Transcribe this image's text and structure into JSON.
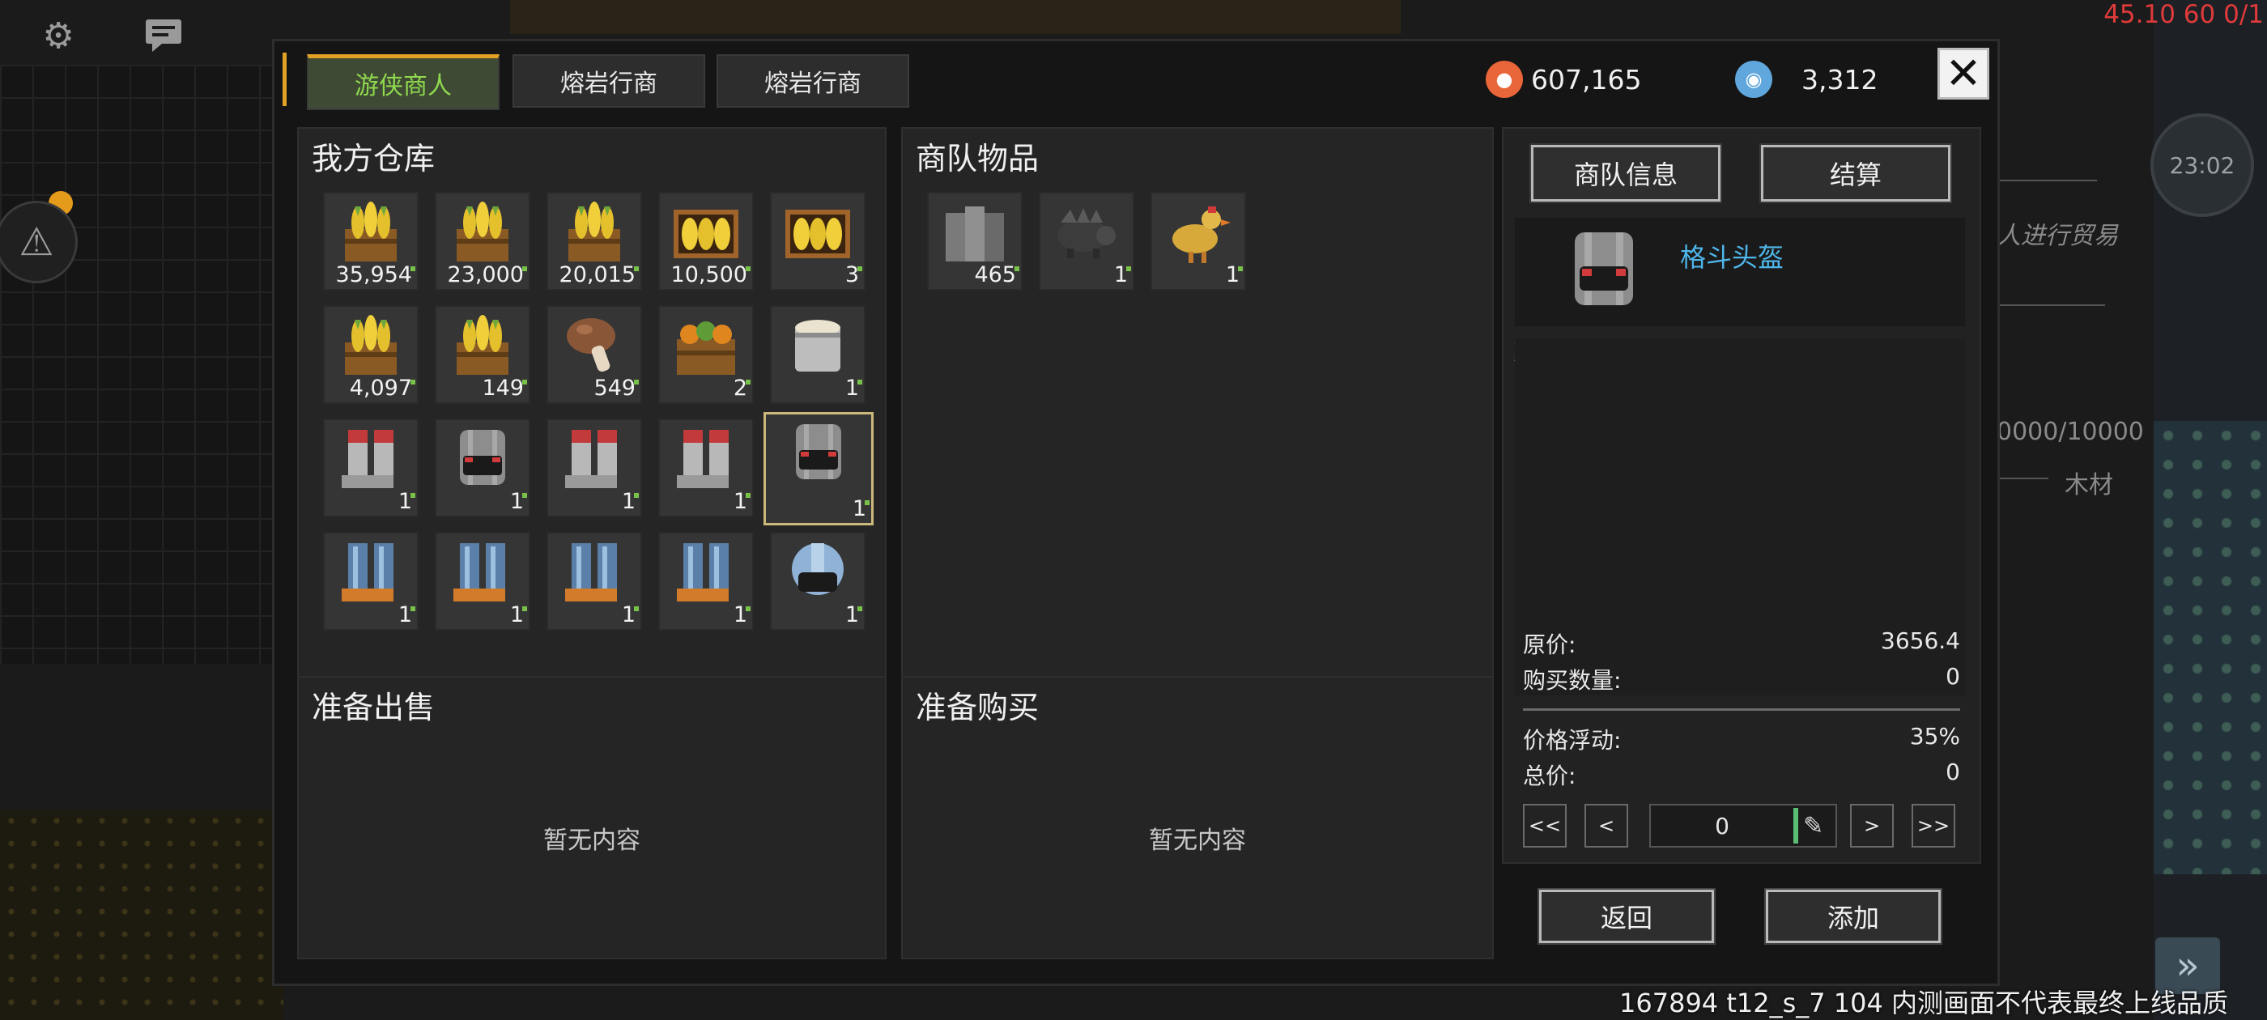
{
  "status_overlay": "45.10 60 0/1",
  "clock": "23:02",
  "side_texts": {
    "trade_hint": "人进行贸易",
    "capacity": "0000/10000",
    "wood": "木材"
  },
  "watermark": "167894 t12_s_7 104 内测画面不代表最终上线品质",
  "tabs": [
    {
      "label": "游侠商人",
      "active": true
    },
    {
      "label": "熔岩行商",
      "active": false
    },
    {
      "label": "熔岩行商",
      "active": false
    }
  ],
  "currency": {
    "silver": "607,165",
    "tokens": "3,312"
  },
  "close_label": "✕",
  "warehouse": {
    "title": "我方仓库",
    "items": [
      {
        "icon": "corn-crate-icon",
        "count": "35,954"
      },
      {
        "icon": "corn-crate-icon",
        "count": "23,000"
      },
      {
        "icon": "corn-crate-icon",
        "count": "20,015"
      },
      {
        "icon": "corn-box-icon",
        "count": "10,500"
      },
      {
        "icon": "corn-box-icon",
        "count": "3"
      },
      {
        "icon": "corn-crate-icon",
        "count": "4,097"
      },
      {
        "icon": "corn-crate-icon",
        "count": "149"
      },
      {
        "icon": "mushroom-icon",
        "count": "549"
      },
      {
        "icon": "vegetable-crate-icon",
        "count": "2"
      },
      {
        "icon": "pot-icon",
        "count": "1"
      },
      {
        "icon": "red-boots-icon",
        "count": "1"
      },
      {
        "icon": "gray-helmet-icon",
        "count": "1"
      },
      {
        "icon": "red-boots-icon",
        "count": "1"
      },
      {
        "icon": "red-boots-icon",
        "count": "1"
      },
      {
        "icon": "gray-helmet-icon",
        "count": "1",
        "selected": true
      },
      {
        "icon": "blue-boots-icon",
        "count": "1"
      },
      {
        "icon": "blue-boots-icon",
        "count": "1"
      },
      {
        "icon": "blue-boots-icon",
        "count": "1"
      },
      {
        "icon": "blue-boots-icon",
        "count": "1"
      },
      {
        "icon": "blue-helmet-icon",
        "count": "1"
      }
    ]
  },
  "caravan": {
    "title": "商队物品",
    "items": [
      {
        "icon": "metal-plates-icon",
        "count": "465"
      },
      {
        "icon": "boar-icon",
        "count": "1"
      },
      {
        "icon": "chicken-icon",
        "count": "1"
      }
    ]
  },
  "sell_panel": {
    "title": "准备出售",
    "empty": "暂无内容"
  },
  "buy_panel": {
    "title": "准备购买",
    "empty": "暂无内容"
  },
  "info": {
    "tab_info": "商队信息",
    "tab_settle": "结算",
    "item_name": "格斗头盔",
    "item_id": "克里斯托_镜面_头盔_3",
    "rows": {
      "base_price_label": "原价:",
      "base_price": "3656.4",
      "buy_qty_label": "购买数量:",
      "buy_qty": "0",
      "fluct_label": "价格浮动:",
      "fluct": "35%",
      "total_label": "总价:",
      "total": "0"
    },
    "nav": {
      "first": "<<",
      "prev": "<",
      "next": ">",
      "last": ">>"
    },
    "quantity": "0",
    "back": "返回",
    "add": "添加"
  },
  "colors": {
    "accent_green": "#8fd94f",
    "tab_gold": "#e2a225",
    "link_blue": "#4fb6ea",
    "silver_coin": "#e8663a",
    "token_coin": "#5fa7dc"
  }
}
